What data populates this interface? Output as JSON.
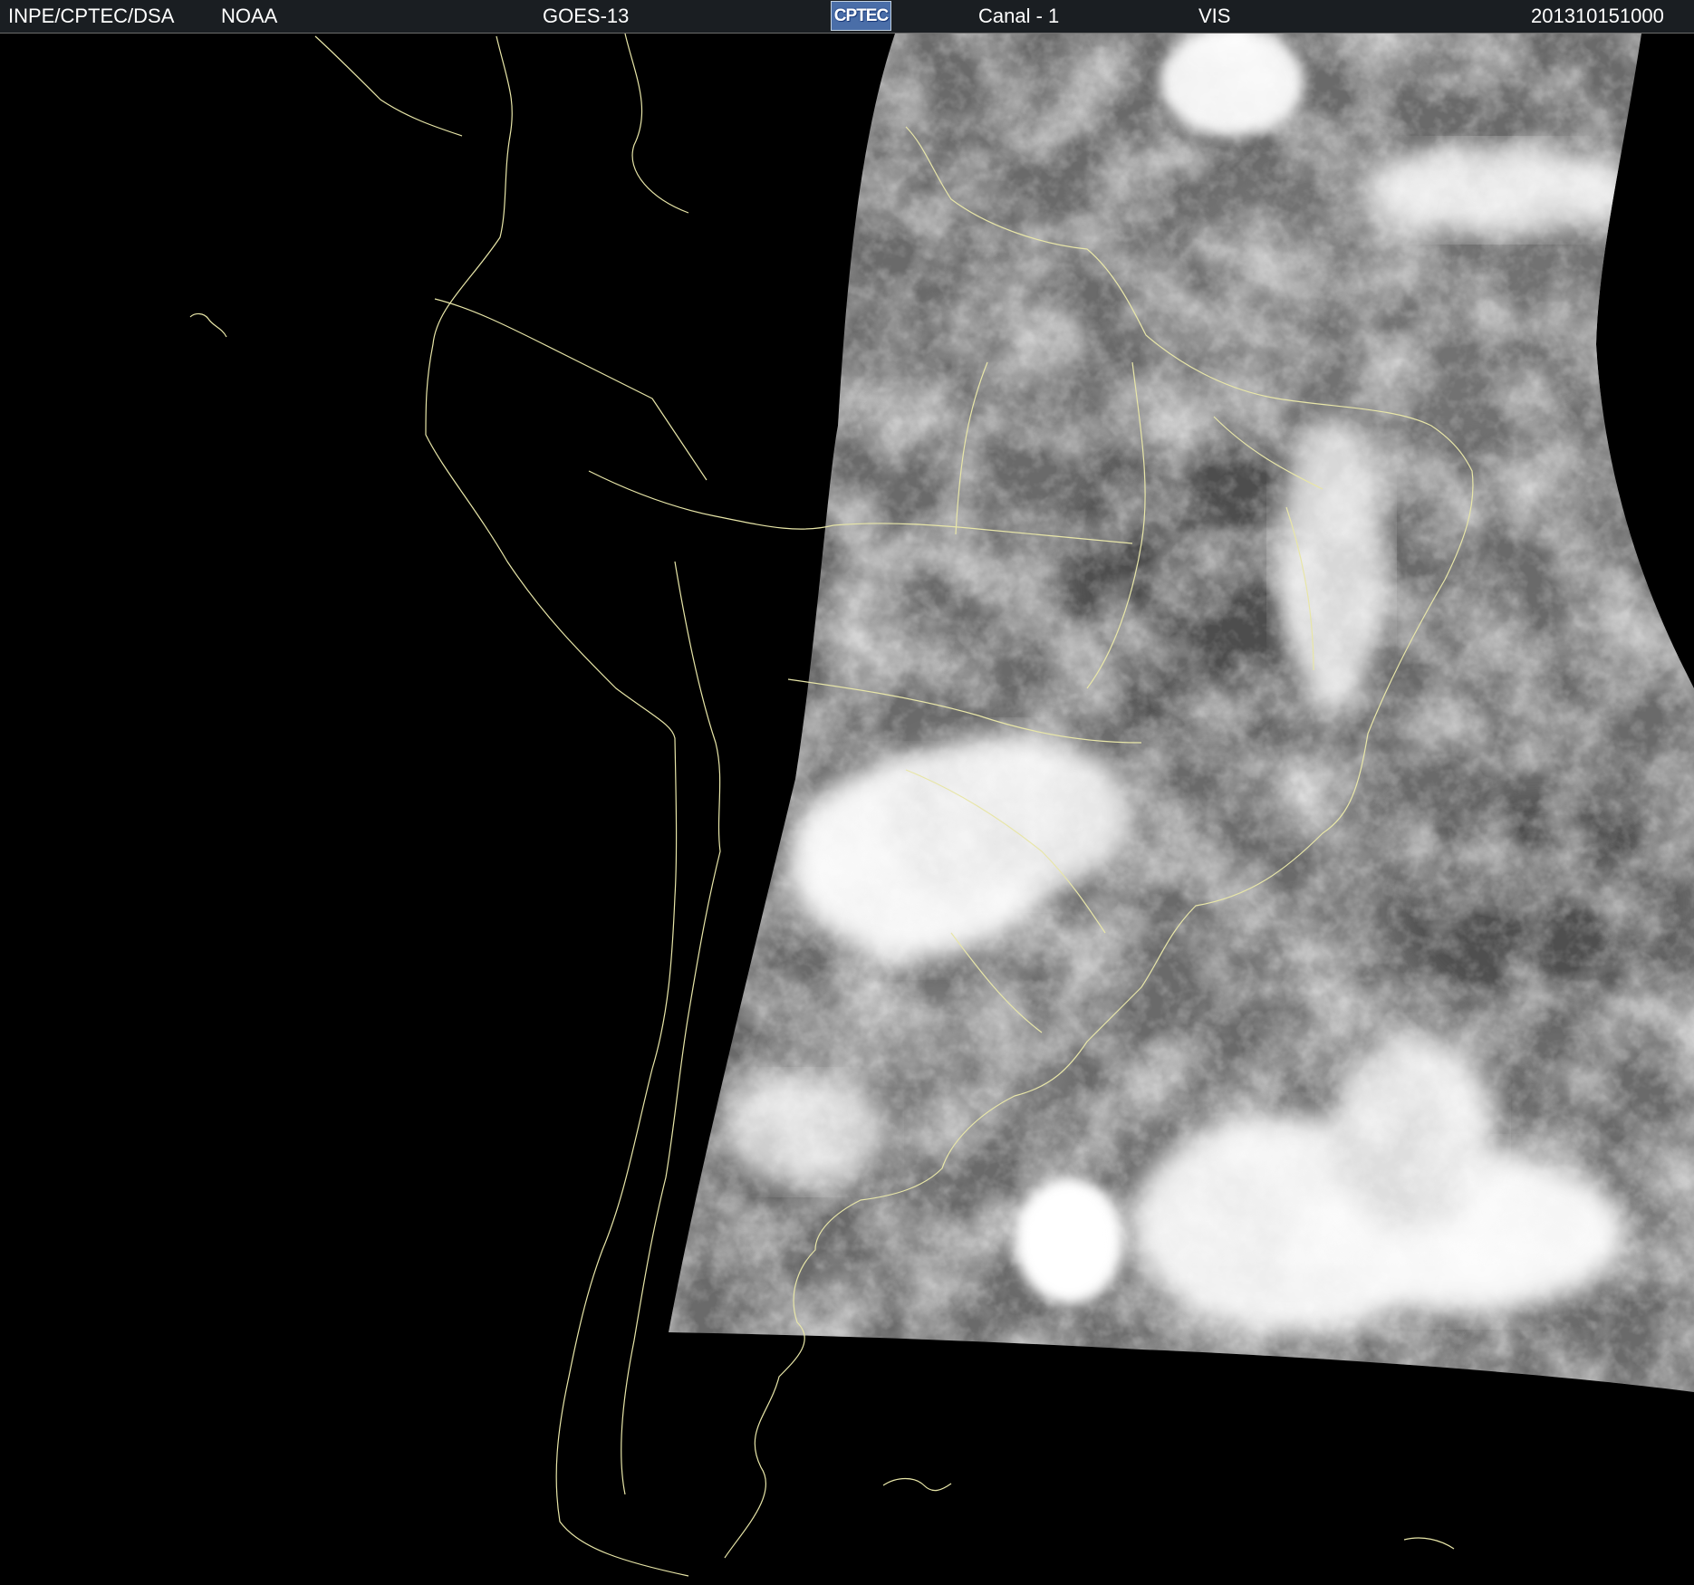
{
  "header": {
    "agency": "INPE/CPTEC/DSA",
    "source": "NOAA",
    "satellite": "GOES-13",
    "logo_text": "CPTEC",
    "channel": "Canal - 1",
    "band": "VIS",
    "timestamp": "201310151000"
  },
  "colors": {
    "background": "#000000",
    "header_bg": "#1a1e22",
    "text": "#ffffff",
    "coastline": "#e8e6a8",
    "logo_bg": "#4a6ea8"
  },
  "image": {
    "type": "satellite-visible-imagery",
    "region": "south-america"
  }
}
